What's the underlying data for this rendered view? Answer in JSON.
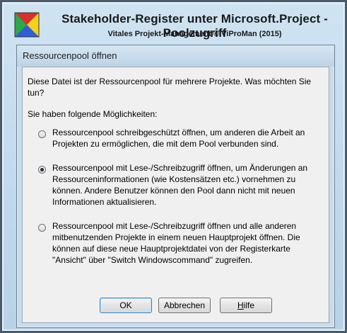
{
  "banner": {
    "title": "Stakeholder-Register unter Microsoft.Project - Poolzugriff",
    "subtitle": "Vitales Projekt-Management © ViProMan  (2015)"
  },
  "dialog": {
    "title": "Ressourcenpool öffnen",
    "question": "Diese Datei ist der Ressourcenpool für mehrere Projekte. Was möchten Sie tun?",
    "options_label": "Sie haben folgende Möglichkeiten:",
    "options": [
      {
        "label": "Ressourcenpool schreibgeschützt öffnen, um anderen die Arbeit an Projekten zu ermöglichen, die mit dem Pool verbunden sind.",
        "selected": false
      },
      {
        "label": "Ressourcenpool mit Lese-/Schreibzugriff öffnen, um Änderungen an Ressourceninformationen (wie Kostensätzen etc.) vornehmen zu können. Andere Benutzer können den Pool dann nicht mit neuen Informationen aktualisieren.",
        "selected": true
      },
      {
        "label": "Ressourcenpool mit Lese-/Schreibzugriff öffnen und alle anderen mitbenutzenden Projekte in einem neuen Hauptprojekt öffnen. Die können auf diese neue Hauptprojektdatei von der Registerkarte \"Ansicht\" über \"Switch Windowscommand\" zugreifen.",
        "selected": false
      }
    ],
    "buttons": {
      "ok": "OK",
      "cancel": "Abbrechen",
      "help_underlined": "H",
      "help_rest": "ilfe"
    }
  },
  "colors": {
    "frame_background": "#c4dbed",
    "dialog_content": "#f0f0f0",
    "logo_blue": "#2f5fd8",
    "logo_yellow": "#f2d21a",
    "logo_green": "#2aa84a",
    "logo_red": "#d8302a"
  }
}
